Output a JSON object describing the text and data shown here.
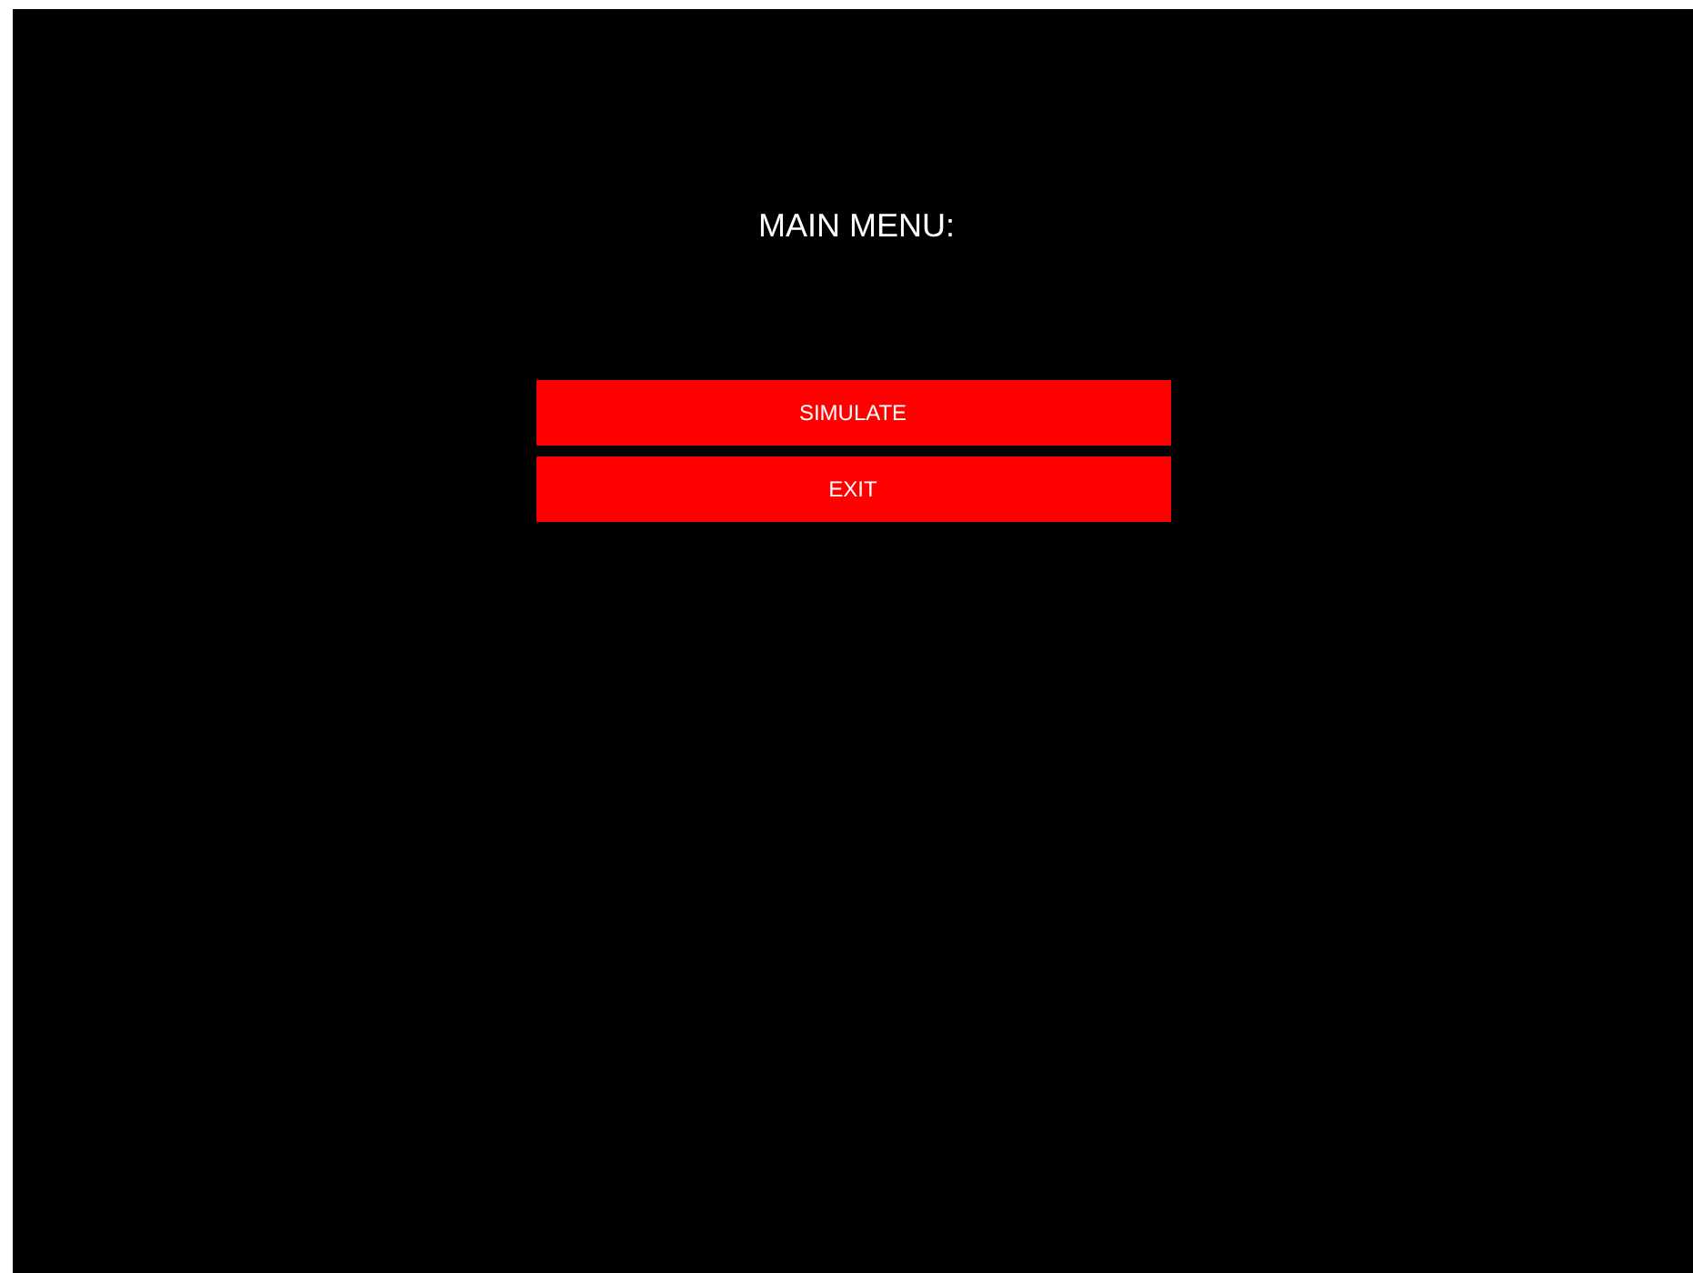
{
  "title": "MAIN MENU:",
  "buttons": [
    {
      "label": "SIMULATE"
    },
    {
      "label": "EXIT"
    }
  ]
}
